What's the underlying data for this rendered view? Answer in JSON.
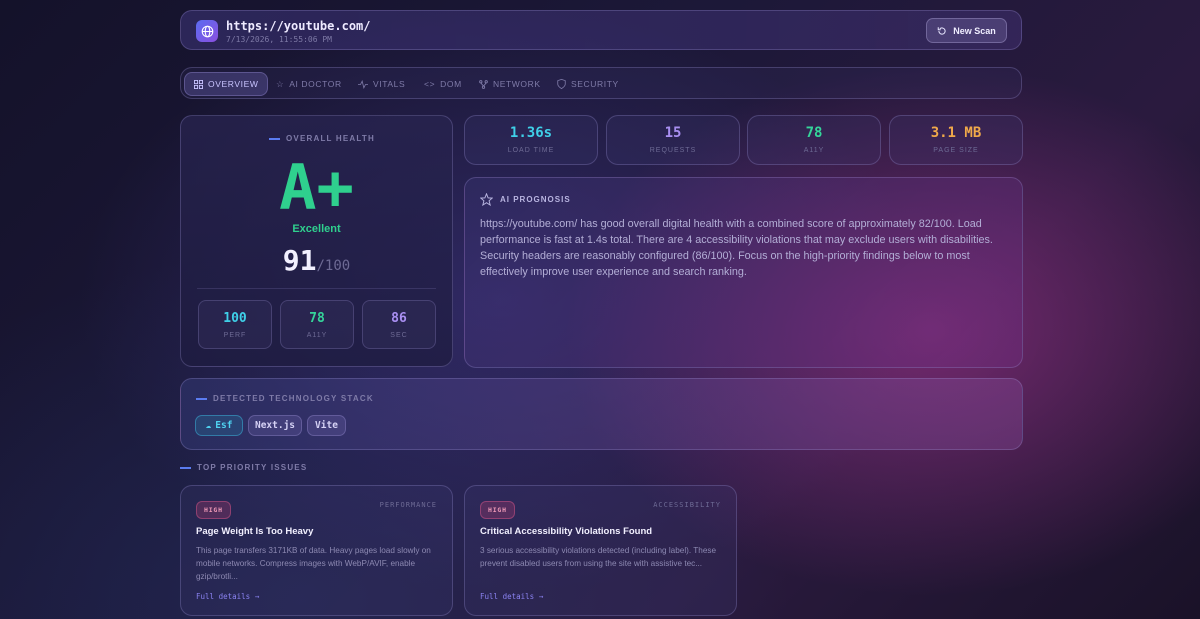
{
  "header": {
    "url": "https://youtube.com/",
    "timestamp": "7/13/2026, 11:55:06 PM",
    "new_scan_label": "New Scan"
  },
  "tabs": [
    {
      "label": "OVERVIEW",
      "icon": "grid-icon",
      "active": true
    },
    {
      "label": "AI DOCTOR",
      "icon": "star-icon"
    },
    {
      "label": "VITALS",
      "icon": "pulse-icon"
    },
    {
      "label": "DOM",
      "icon": "code-icon"
    },
    {
      "label": "NETWORK",
      "icon": "network-icon"
    },
    {
      "label": "SECURITY",
      "icon": "shield-icon"
    }
  ],
  "health": {
    "label": "OVERALL HEALTH",
    "grade": "A+",
    "grade_text": "Excellent",
    "score": "91",
    "score_max": "/100",
    "subs": [
      {
        "value": "100",
        "label": "PERF",
        "color": "#3fd0e8"
      },
      {
        "value": "78",
        "label": "A11Y",
        "color": "#35d49a"
      },
      {
        "value": "86",
        "label": "SEC",
        "color": "#a98ff2"
      }
    ]
  },
  "metrics": [
    {
      "value": "1.36s",
      "label": "LOAD TIME",
      "color": "#3fd0e8"
    },
    {
      "value": "15",
      "label": "REQUESTS",
      "color": "#a98ff2"
    },
    {
      "value": "78",
      "label": "A11Y",
      "color": "#35d49a"
    },
    {
      "value": "3.1 MB",
      "label": "PAGE SIZE",
      "color": "#f0a94a"
    }
  ],
  "prognosis": {
    "label": "AI PROGNOSIS",
    "text": "https://youtube.com/ has good overall digital health with a combined score of approximately 82/100. Load performance is fast at 1.4s total. There are 4 accessibility violations that may exclude users with disabilities. Security headers are reasonably configured (86/100). Focus on the high-priority findings below to most effectively improve user experience and search ranking."
  },
  "tech": {
    "label": "DETECTED TECHNOLOGY STACK",
    "chips": [
      "Esf",
      "Next.js",
      "Vite"
    ]
  },
  "issues": {
    "label": "TOP PRIORITY ISSUES",
    "items": [
      {
        "badge": "HIGH",
        "category": "PERFORMANCE",
        "title": "Page Weight Is Too Heavy",
        "desc": "This page transfers 3171KB of data. Heavy pages load slowly on mobile networks. Compress images with WebP/AVIF, enable gzip/brotli...",
        "link": "Full details →"
      },
      {
        "badge": "HIGH",
        "category": "ACCESSIBILITY",
        "title": "Critical Accessibility Violations Found",
        "desc": "3 serious accessibility violations detected (including label). These prevent disabled users from using the site with assistive tec...",
        "link": "Full details →"
      }
    ]
  }
}
